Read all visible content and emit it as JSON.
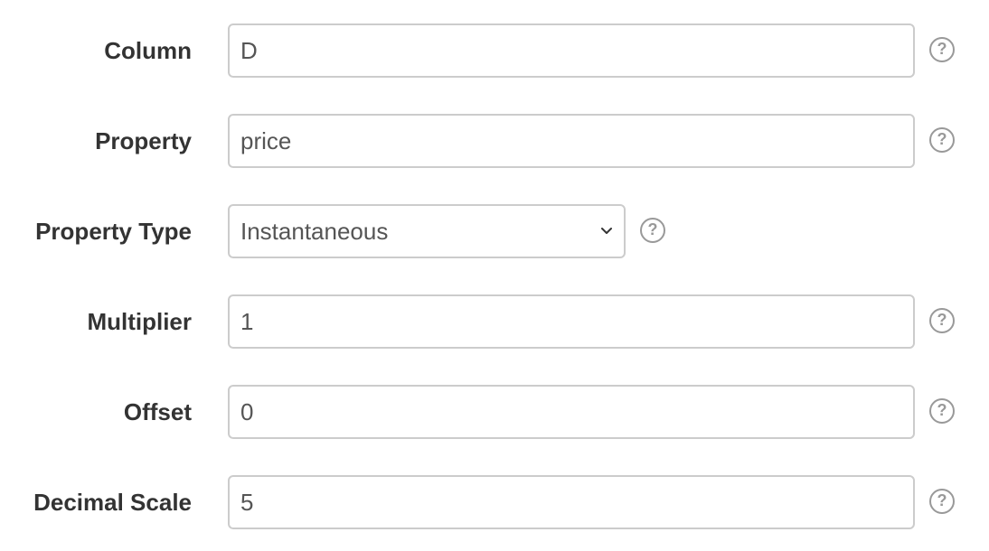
{
  "fields": {
    "column": {
      "label": "Column",
      "value": "D"
    },
    "property": {
      "label": "Property",
      "value": "price"
    },
    "property_type": {
      "label": "Property Type",
      "value": "Instantaneous"
    },
    "multiplier": {
      "label": "Multiplier",
      "value": "1"
    },
    "offset": {
      "label": "Offset",
      "value": "0"
    },
    "decimal_scale": {
      "label": "Decimal Scale",
      "value": "5"
    }
  },
  "help_glyph": "?",
  "icons": {
    "help": "question-circle-icon",
    "select_arrow": "chevron-down-icon"
  }
}
